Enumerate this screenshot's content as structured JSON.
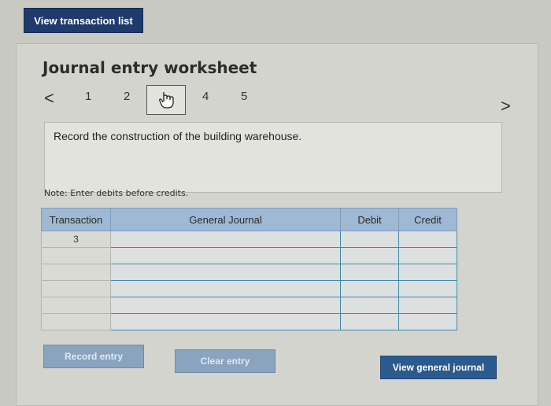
{
  "top": {
    "view_transactions_label": "View transaction list"
  },
  "worksheet": {
    "title": "Journal entry worksheet",
    "steps": [
      "1",
      "2",
      "3",
      "4",
      "5"
    ],
    "active_step": "3",
    "prompt": "Record the construction of the building warehouse.",
    "note": "Note: Enter debits before credits."
  },
  "table": {
    "headers": [
      "Transaction",
      "General Journal",
      "Debit",
      "Credit"
    ],
    "rows": [
      [
        "3",
        "",
        "",
        ""
      ],
      [
        "",
        "",
        "",
        ""
      ],
      [
        "",
        "",
        "",
        ""
      ],
      [
        "",
        "",
        "",
        ""
      ],
      [
        "",
        "",
        "",
        ""
      ],
      [
        "",
        "",
        "",
        ""
      ]
    ]
  },
  "buttons": {
    "record_entry": "Record entry",
    "clear_entry": "Clear entry",
    "view_general_journal": "View general journal"
  }
}
